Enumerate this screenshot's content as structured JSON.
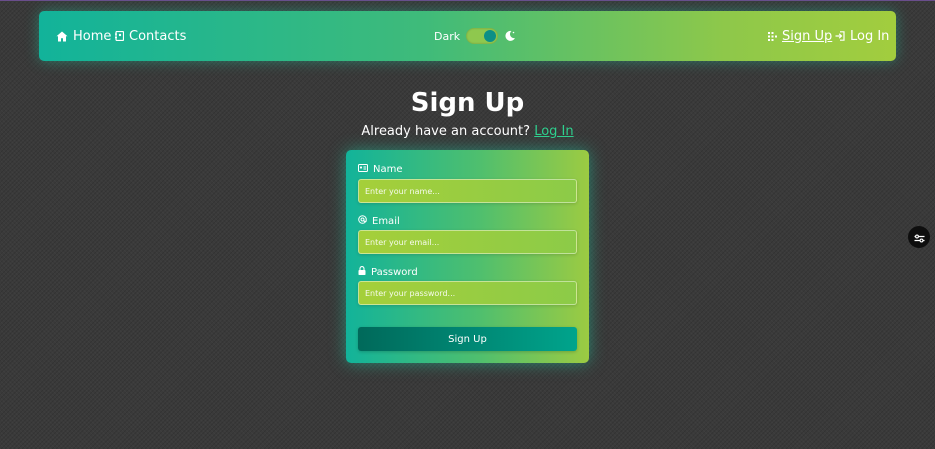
{
  "nav": {
    "home_label": "Home",
    "contacts_label": "Contacts",
    "theme_label": "Dark",
    "signup_label": "Sign Up",
    "login_label": "Log In"
  },
  "header": {
    "title": "Sign Up",
    "subtitle_prefix": "Already have an account?",
    "subtitle_link": "Log In"
  },
  "form": {
    "name": {
      "label": "Name",
      "value": "",
      "placeholder": "Enter your name..."
    },
    "email": {
      "label": "Email",
      "value": "",
      "placeholder": "Enter your email..."
    },
    "password": {
      "label": "Password",
      "value": "",
      "placeholder": "Enter your password..."
    },
    "submit_label": "Sign Up"
  },
  "colors": {
    "gradient_start": "#12b39a",
    "gradient_end": "#a2cd3e",
    "link_accent": "#2fd08f",
    "button_dark": "#00695a",
    "background": "#3a3a3a"
  },
  "icons": {
    "home": "home-icon",
    "contacts": "address-book-icon",
    "theme": "moon-icon",
    "signup": "signup-icon",
    "login": "login-icon",
    "name_field": "id-card-icon",
    "email_field": "at-icon",
    "password_field": "lock-icon",
    "floating": "settings-sliders-icon"
  }
}
